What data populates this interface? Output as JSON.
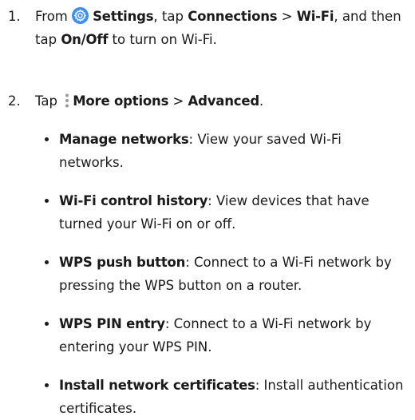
{
  "steps": [
    {
      "number": "1.",
      "pre": "From ",
      "settings_label": "Settings",
      "mid1": ", tap ",
      "connections_label": "Connections",
      "sep1": " > ",
      "wifi_label": "Wi-Fi",
      "mid2": ", and then tap ",
      "onoff_label": "On/Off",
      "post": " to turn on Wi-Fi."
    },
    {
      "number": "2.",
      "pre": "Tap ",
      "more_options_label": "More options",
      "sep": " > ",
      "advanced_label": "Advanced",
      "post": "."
    }
  ],
  "bullets": [
    {
      "title": "Manage networks",
      "text": ": View your saved Wi-Fi networks."
    },
    {
      "title": "Wi-Fi control history",
      "text": ": View devices that have turned your Wi-Fi on or off."
    },
    {
      "title": "WPS push button",
      "text": ": Connect to a Wi-Fi network by pressing the WPS button on a router."
    },
    {
      "title": "WPS PIN entry",
      "text": ": Connect to a Wi-Fi network by entering your WPS PIN."
    },
    {
      "title": "Install network certificates",
      "text": ": Install authentication certificates."
    }
  ],
  "icons": {
    "settings": "settings-gear-icon",
    "more_options": "more-options-vertical-dots-icon"
  },
  "colors": {
    "settings_icon_bg": "#3b8df0",
    "text": "#1a1a1a"
  }
}
